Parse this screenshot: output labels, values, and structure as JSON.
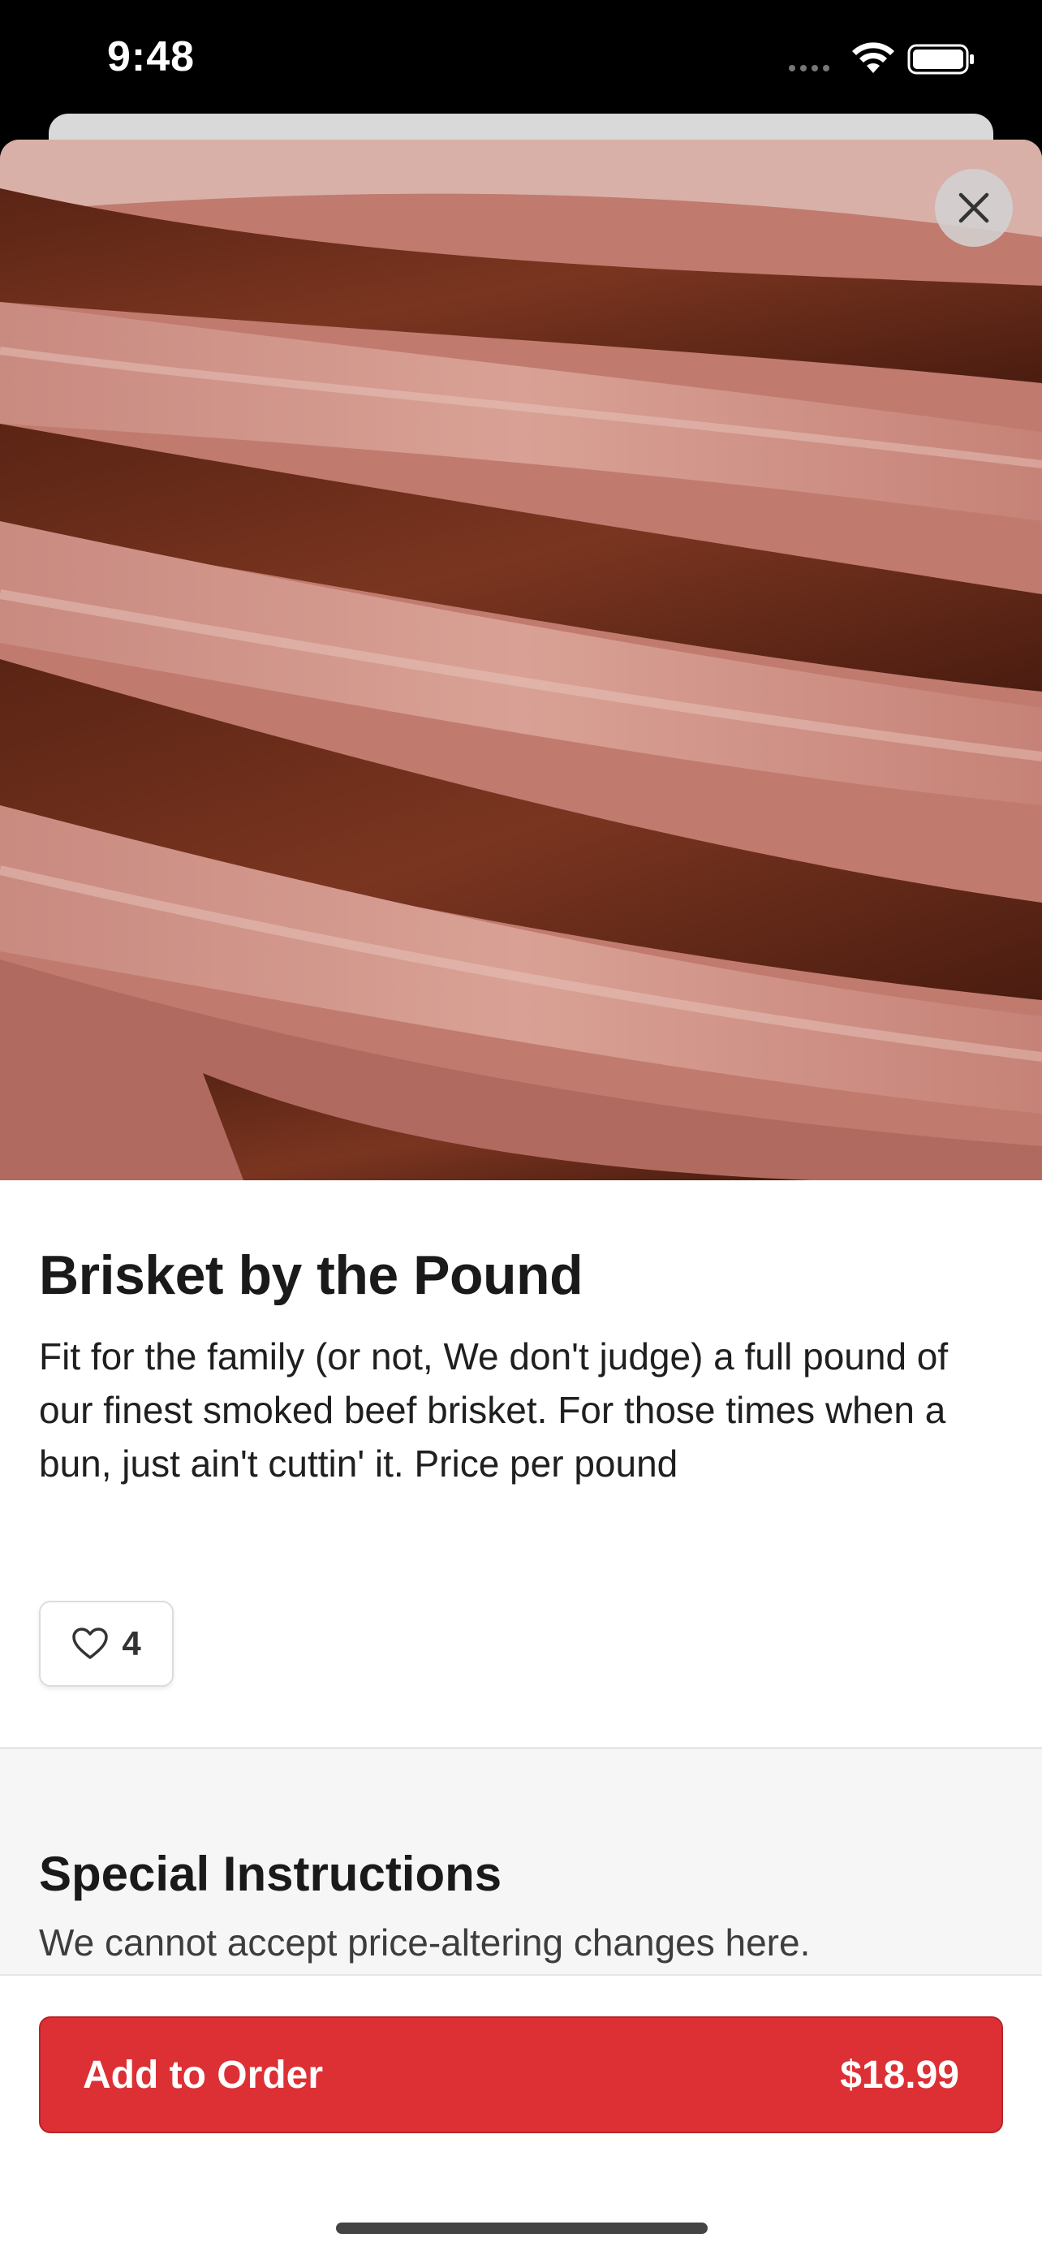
{
  "status_bar": {
    "time": "9:48"
  },
  "product": {
    "title": "Brisket by the Pound",
    "description": "Fit for the family (or not, We don't judge) a full pound of our finest smoked beef brisket. For those times when a bun, just ain't cuttin' it. Price per pound",
    "likes": "4",
    "image_icon": "brisket-photo"
  },
  "special_instructions": {
    "title": "Special Instructions",
    "note": "We cannot accept price-altering changes here."
  },
  "footer": {
    "add_label": "Add to Order",
    "price": "$18.99"
  },
  "icons": {
    "close": "close-icon",
    "like": "heart-icon"
  },
  "colors": {
    "accent": "#dc3035",
    "text": "#1a1a1a"
  }
}
